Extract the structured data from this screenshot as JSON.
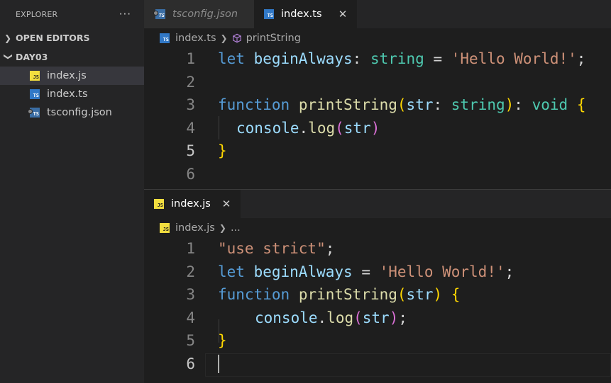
{
  "explorer": {
    "title": "EXPLORER",
    "more": "···",
    "sections": {
      "open_editors": "OPEN EDITORS",
      "folder": "DAY03"
    },
    "files": [
      {
        "name": "index.js",
        "icon": "js-file-icon",
        "badge": "JS"
      },
      {
        "name": "index.ts",
        "icon": "ts-file-icon",
        "badge": "TS"
      },
      {
        "name": "tsconfig.json",
        "icon": "tsconfig-file-icon",
        "badge": "TS"
      }
    ]
  },
  "top_pane": {
    "tabs": [
      {
        "label": "tsconfig.json",
        "badge": "TS"
      },
      {
        "label": "index.ts",
        "badge": "TS",
        "close": "✕"
      }
    ],
    "breadcrumb": {
      "file": "index.ts",
      "symbol": "printString",
      "badge": "TS"
    },
    "line_numbers": [
      "1",
      "2",
      "3",
      "4",
      "5",
      "6"
    ],
    "code": {
      "l1": {
        "kw": "let",
        "name": "beginAlways",
        "colon": ": ",
        "type": "string",
        "eq": " = ",
        "str": "'Hello World!'",
        "semi": ";"
      },
      "l3": {
        "kw": "function",
        "fn": "printString",
        "open": "(",
        "param": "str",
        "colon": ": ",
        "ptype": "string",
        "close": ")",
        "colon2": ": ",
        "ret": "void",
        "brace": "{"
      },
      "l4": {
        "obj": "console",
        "dot": ".",
        "method": "log",
        "open": "(",
        "arg": "str",
        "close": ")"
      },
      "l5": {
        "brace": "}"
      }
    }
  },
  "bottom_pane": {
    "tabs": [
      {
        "label": "index.js",
        "badge": "JS",
        "close": "✕"
      }
    ],
    "breadcrumb": {
      "file": "index.js",
      "symbol": "...",
      "badge": "JS"
    },
    "line_numbers": [
      "1",
      "2",
      "3",
      "4",
      "5",
      "6"
    ],
    "code": {
      "l1": {
        "str": "\"use strict\"",
        "semi": ";"
      },
      "l2": {
        "kw": "let",
        "name": "beginAlways",
        "eq": " = ",
        "str": "'Hello World!'",
        "semi": ";"
      },
      "l3": {
        "kw": "function",
        "fn": "printString",
        "open": "(",
        "param": "str",
        "close": ")",
        "brace": "{"
      },
      "l4": {
        "obj": "console",
        "dot": ".",
        "method": "log",
        "open": "(",
        "arg": "str",
        "close": ")",
        "semi": ";"
      },
      "l5": {
        "brace": "}"
      }
    }
  }
}
